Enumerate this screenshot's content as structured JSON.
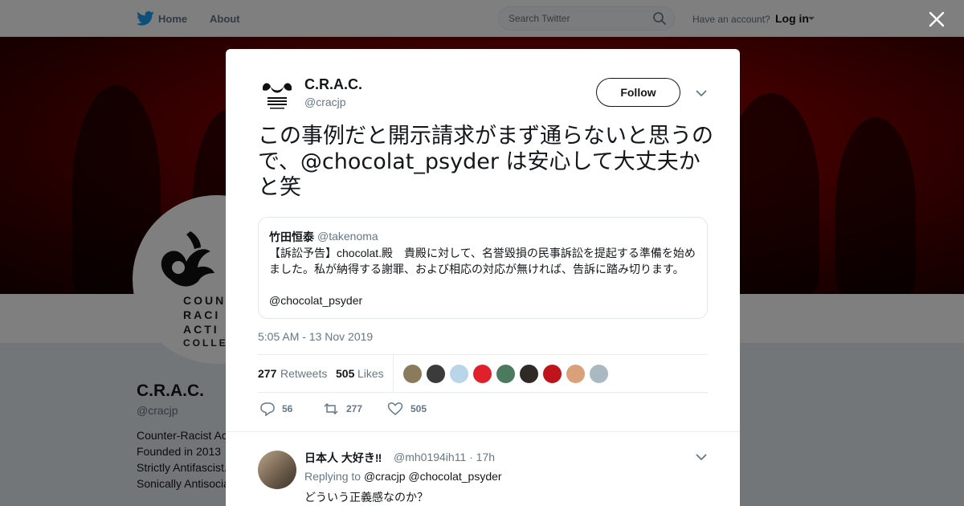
{
  "nav": {
    "home": "Home",
    "about": "About",
    "search_placeholder": "Search Twitter",
    "have_account": "Have an account?",
    "login": "Log in"
  },
  "background_profile": {
    "name": "C.R.A.C.",
    "handle": "@cracjp",
    "bio_lines": [
      "Counter-Racist Ac",
      "Founded in 2013",
      "Strictly Antifascist.",
      "Sonically Antisocia"
    ],
    "avatar_text": [
      "COUN",
      "RACI",
      "ACTI",
      "COLLEC"
    ]
  },
  "tweet": {
    "author_name": "C.R.A.C.",
    "author_handle": "@cracjp",
    "follow_label": "Follow",
    "text_before": "この事例だと開示請求がまず通らないと思うので、",
    "mention": "@chocolat_psyder",
    "text_after": " は安心して大丈夫かと笑",
    "quote": {
      "name": "竹田恒泰",
      "handle": "@takenoma",
      "body": "【訴訟予告】chocolat.殿　貴殿に対して、名誉毀損の民事訴訟を提起する準備を始めました。私が納得する謝罪、および相応の対応が無ければ、告訴に踏み切ります。",
      "mention": "@chocolat_psyder"
    },
    "time": "5:05 AM - 13 Nov 2019",
    "retweets_count": "277",
    "retweets_label": "Retweets",
    "likes_count": "505",
    "likes_label": "Likes",
    "likers": [
      "#8a7b5c",
      "#3b3b3b",
      "#b9d6e8",
      "#e0202a",
      "#4c7a5e",
      "#2f2a26",
      "#c0141c",
      "#d9a07a",
      "#aab8c2"
    ],
    "actions": {
      "replies": "56",
      "retweets": "277",
      "likes": "505"
    }
  },
  "reply": {
    "name": "日本人 大好き‼",
    "meta": "@mh0194ih11 · 17h",
    "replying_label": "Replying to",
    "replying_to_1": "@cracjp",
    "replying_to_2": "@chocolat_psyder",
    "text": "どういう正義感なのか？"
  },
  "colors": {
    "twitter_blue": "#1da1f2",
    "muted": "#657786",
    "banner_red": "#a00000"
  }
}
